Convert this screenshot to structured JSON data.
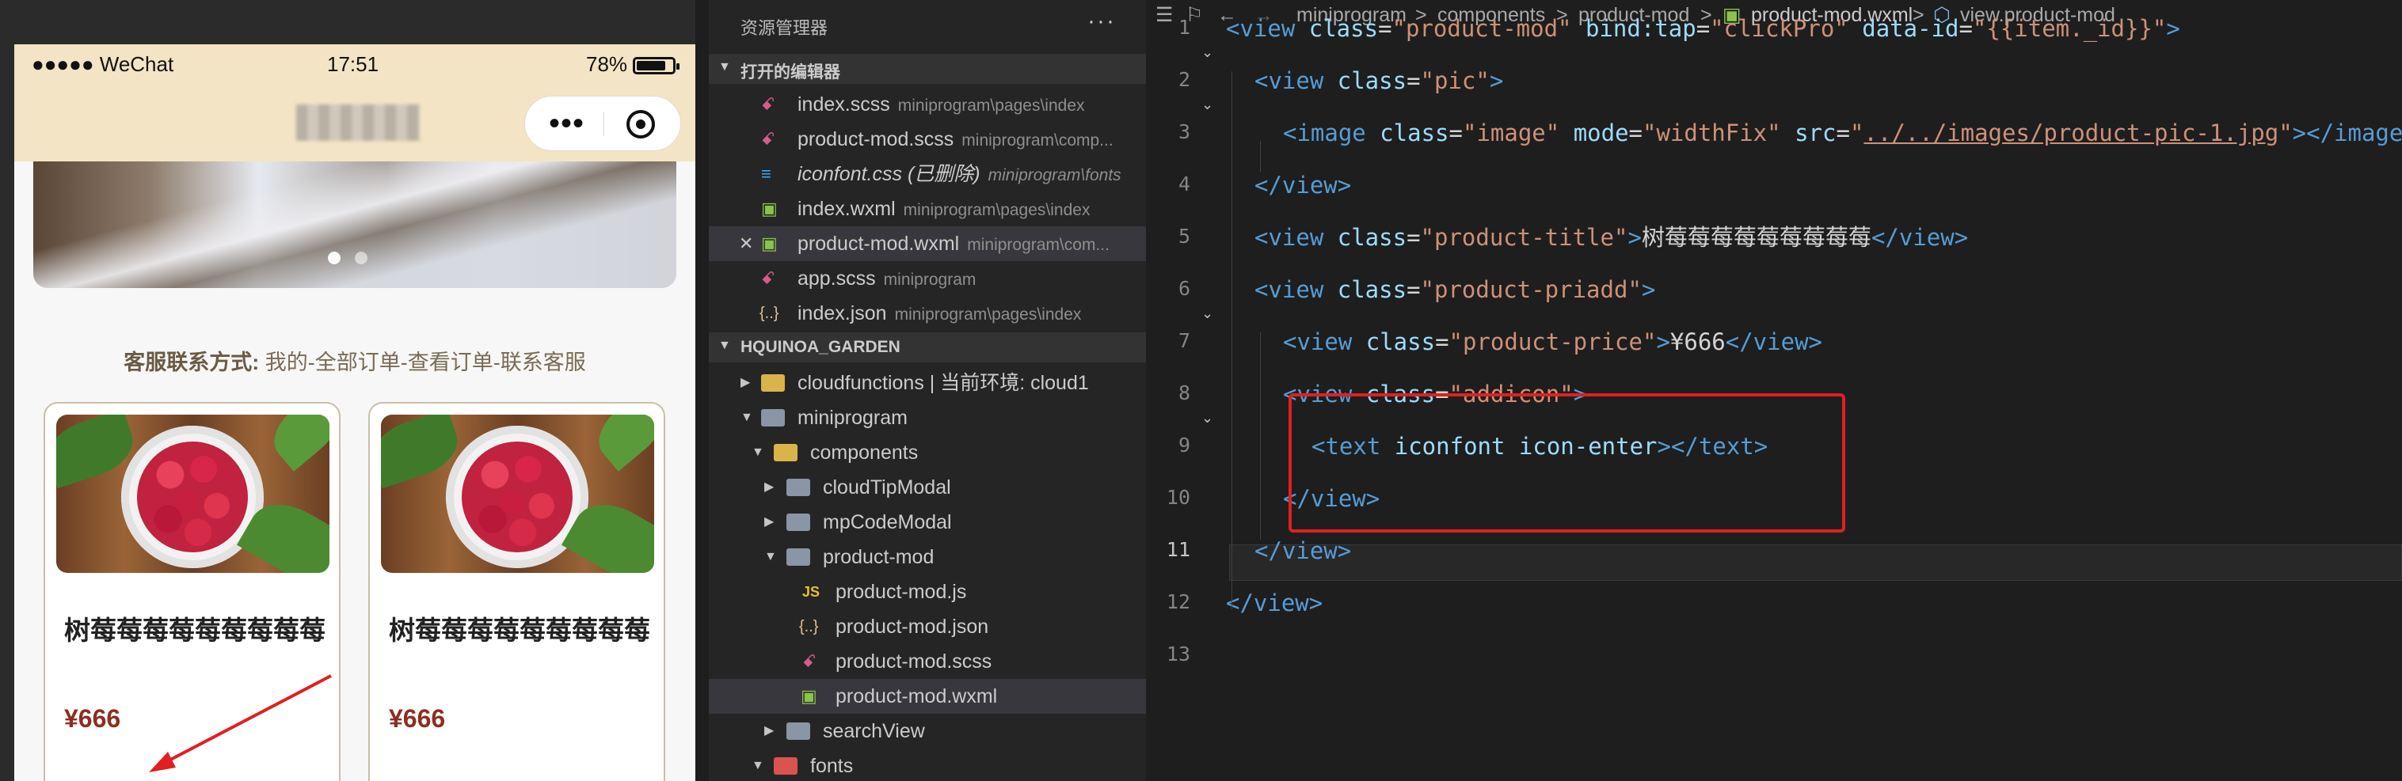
{
  "phone": {
    "status": {
      "carrier": "●●●●● WeChat",
      "time": "17:51",
      "battery": "78%"
    },
    "service": {
      "label": "客服联系方式:",
      "text": " 我的-全部订单-查看订单-联系客服"
    },
    "products": [
      {
        "title": "树莓莓莓莓莓莓莓莓莓",
        "price": "¥666"
      },
      {
        "title": "树莓莓莓莓莓莓莓莓莓",
        "price": "¥666"
      }
    ]
  },
  "explorer": {
    "title": "资源管理器",
    "more": "···",
    "open_editors": {
      "header": "打开的编辑器",
      "items": [
        {
          "name": "index.scss",
          "path": "miniprogram\\pages\\index",
          "icon": "scss-icon"
        },
        {
          "name": "product-mod.scss",
          "path": "miniprogram\\comp...",
          "icon": "scss-icon"
        },
        {
          "name": "iconfont.css (已删除)",
          "path": "miniprogram\\fonts",
          "icon": "css-icon"
        },
        {
          "name": "index.wxml",
          "path": "miniprogram\\pages\\index",
          "icon": "wxml-icon"
        },
        {
          "name": "product-mod.wxml",
          "path": "miniprogram\\com...",
          "icon": "wxml-icon"
        },
        {
          "name": "app.scss",
          "path": "miniprogram",
          "icon": "scss-icon"
        },
        {
          "name": "index.json",
          "path": "miniprogram\\pages\\index",
          "icon": "json-icon"
        }
      ]
    },
    "project": {
      "header": "HQUINOA_GARDEN",
      "items": [
        {
          "name": "cloudfunctions | 当前环境: cloud1"
        },
        {
          "name": "miniprogram"
        },
        {
          "name": "components"
        },
        {
          "name": "cloudTipModal"
        },
        {
          "name": "mpCodeModal"
        },
        {
          "name": "product-mod"
        },
        {
          "name": "product-mod.js"
        },
        {
          "name": "product-mod.json"
        },
        {
          "name": "product-mod.scss"
        },
        {
          "name": "product-mod.wxml"
        },
        {
          "name": "searchView"
        },
        {
          "name": "fonts"
        }
      ]
    }
  },
  "editor": {
    "breadcrumbs": [
      "miniprogram",
      ">",
      "components",
      ">",
      "product-mod",
      ">",
      "product-mod.wxml",
      ">",
      "view.product-mod"
    ],
    "line_numbers": [
      "1",
      "2",
      "3",
      "4",
      "5",
      "6",
      "7",
      "8",
      "9",
      "10",
      "11",
      "12",
      "13"
    ],
    "lines": [
      {
        "tokens": [
          [
            "t-tag",
            "<view "
          ],
          [
            "t-attr",
            "class"
          ],
          [
            "t-txt",
            "="
          ],
          [
            "t-str",
            "\"product-mod\""
          ],
          [
            "t-txt",
            " "
          ],
          [
            "t-attr",
            "bind:tap"
          ],
          [
            "t-txt",
            "="
          ],
          [
            "t-str",
            "\"clickPro\""
          ],
          [
            "t-txt",
            " "
          ],
          [
            "t-attr",
            "data-id"
          ],
          [
            "t-txt",
            "="
          ],
          [
            "t-str",
            "\"{{item._id}}\""
          ],
          [
            "t-tag",
            ">"
          ]
        ]
      },
      {
        "tokens": [
          [
            "t-tag",
            "<view "
          ],
          [
            "t-attr",
            "class"
          ],
          [
            "t-txt",
            "="
          ],
          [
            "t-str",
            "\"pic\""
          ],
          [
            "t-tag",
            ">"
          ]
        ]
      },
      {
        "tokens": [
          [
            "t-tag",
            "<image "
          ],
          [
            "t-attr",
            "class"
          ],
          [
            "t-txt",
            "="
          ],
          [
            "t-str",
            "\"image\""
          ],
          [
            "t-txt",
            " "
          ],
          [
            "t-attr",
            "mode"
          ],
          [
            "t-txt",
            "="
          ],
          [
            "t-str",
            "\"widthFix\""
          ],
          [
            "t-txt",
            " "
          ],
          [
            "t-attr",
            "src"
          ],
          [
            "t-txt",
            "="
          ],
          [
            "t-str",
            "\""
          ],
          [
            "t-link",
            "../../images/product-pic-1.jpg"
          ],
          [
            "t-str",
            "\""
          ],
          [
            "t-tag",
            "></image>"
          ]
        ]
      },
      {
        "tokens": [
          [
            "t-tag",
            "</view>"
          ]
        ]
      },
      {
        "tokens": [
          [
            "t-tag",
            "<view "
          ],
          [
            "t-attr",
            "class"
          ],
          [
            "t-txt",
            "="
          ],
          [
            "t-str",
            "\"product-title\""
          ],
          [
            "t-tag",
            ">"
          ],
          [
            "t-txt",
            "树莓莓莓莓莓莓莓莓莓"
          ],
          [
            "t-tag",
            "</view>"
          ]
        ]
      },
      {
        "tokens": [
          [
            "t-tag",
            "<view "
          ],
          [
            "t-attr",
            "class"
          ],
          [
            "t-txt",
            "="
          ],
          [
            "t-str",
            "\"product-priadd\""
          ],
          [
            "t-tag",
            ">"
          ]
        ]
      },
      {
        "tokens": [
          [
            "t-tag",
            "<view "
          ],
          [
            "t-attr",
            "class"
          ],
          [
            "t-txt",
            "="
          ],
          [
            "t-str",
            "\"product-price\""
          ],
          [
            "t-tag",
            ">"
          ],
          [
            "t-txt",
            "¥666"
          ],
          [
            "t-tag",
            "</view>"
          ]
        ]
      },
      {
        "tokens": [
          [
            "t-tag",
            "<view "
          ],
          [
            "t-attr",
            "class"
          ],
          [
            "t-txt",
            "="
          ],
          [
            "t-str",
            "\"addicon\""
          ],
          [
            "t-tag",
            ">"
          ]
        ]
      },
      {
        "tokens": [
          [
            "t-tag",
            "<text "
          ],
          [
            "t-attr",
            "iconfont icon-enter"
          ],
          [
            "t-tag",
            "></text>"
          ]
        ]
      },
      {
        "tokens": [
          [
            "t-tag",
            "</view>"
          ]
        ]
      },
      {
        "tokens": [
          [
            "t-tag",
            "</view>"
          ]
        ]
      },
      {
        "tokens": [
          [
            "t-tag",
            "</view>"
          ]
        ]
      },
      {
        "tokens": []
      }
    ]
  },
  "colors": {
    "highlight": "#e02020",
    "nav": "#f3e4c5",
    "price": "#8b2f1f"
  }
}
